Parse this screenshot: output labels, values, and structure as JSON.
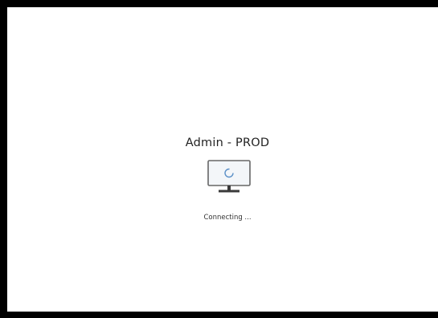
{
  "connection": {
    "name": "Admin - PROD",
    "status": "Connecting ..."
  },
  "icons": {
    "monitor": "monitor-loading-icon"
  },
  "colors": {
    "background": "#ffffff",
    "frame": "#000000",
    "text": "#222222",
    "monitor_outline": "#666666",
    "monitor_screen": "#f3f6f9",
    "spinner": "#5a8fc7"
  }
}
